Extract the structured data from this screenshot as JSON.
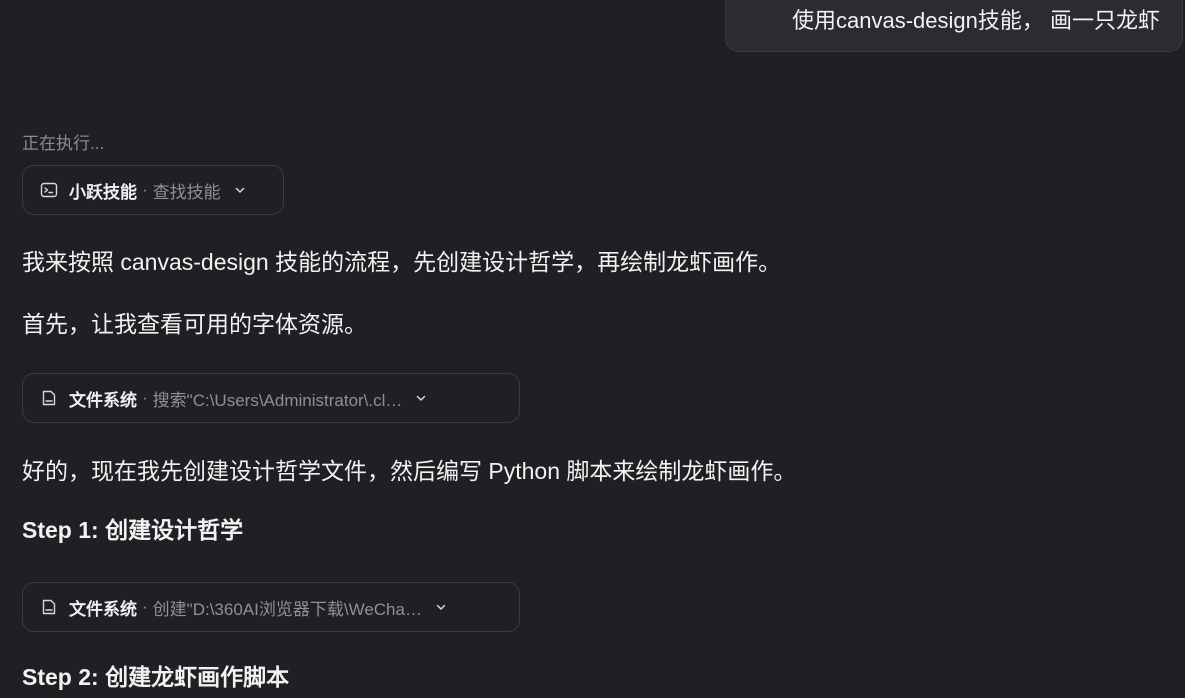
{
  "user_message": "使用canvas-design技能， 画一只龙虾",
  "status": "正在执行...",
  "tool_calls": [
    {
      "icon": "terminal-icon",
      "name": "小跃技能",
      "separator": "·",
      "detail": "查找技能"
    },
    {
      "icon": "file-icon",
      "name": "文件系统",
      "separator": "·",
      "detail": "搜索\"C:\\Users\\Administrator\\.cl…"
    },
    {
      "icon": "file-icon",
      "name": "文件系统",
      "separator": "·",
      "detail": "创建\"D:\\360AI浏览器下载\\WeCha…"
    }
  ],
  "messages": {
    "p1": "我来按照 canvas-design 技能的流程，先创建设计哲学，再绘制龙虾画作。",
    "p2": "首先，让我查看可用的字体资源。",
    "p3": "好的，现在我先创建设计哲学文件，然后编写 Python 脚本来绘制龙虾画作。",
    "step1": "Step 1: 创建设计哲学",
    "step2": "Step 2: 创建龙虾画作脚本"
  }
}
